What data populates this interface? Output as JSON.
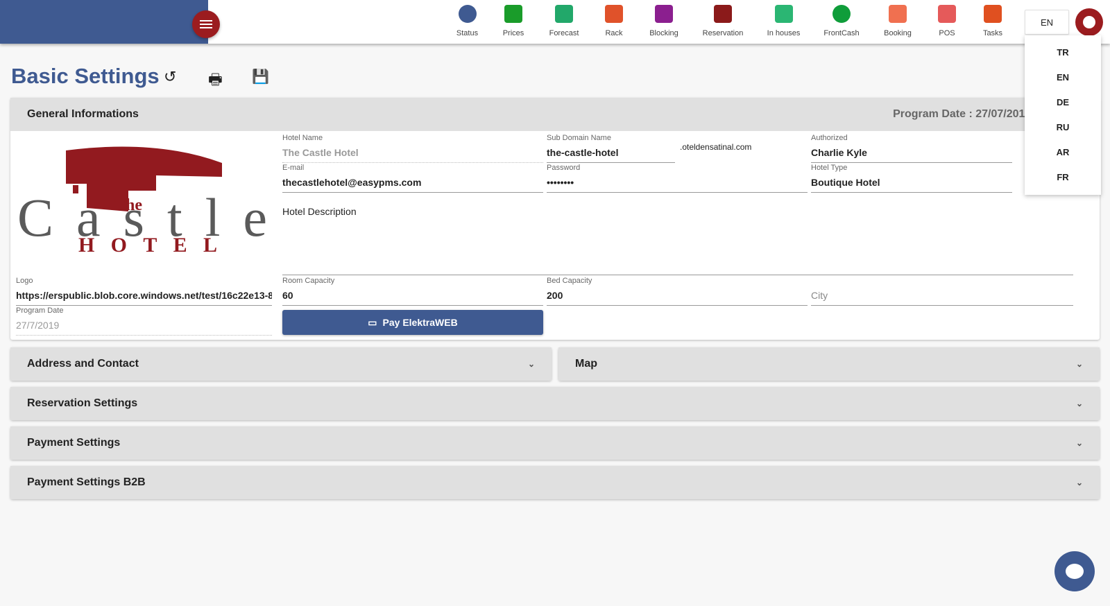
{
  "header": {
    "nav": [
      {
        "label": "Status",
        "icon": "status-pie-icon",
        "color": "#3f5a91"
      },
      {
        "label": "Prices",
        "icon": "prices-icon",
        "color": "#1a9c2a"
      },
      {
        "label": "Forecast",
        "icon": "forecast-chart-icon",
        "color": "#22a86a"
      },
      {
        "label": "Rack",
        "icon": "rack-grid-icon",
        "color": "#e0522a"
      },
      {
        "label": "Blocking",
        "icon": "calendar-icon",
        "color": "#8b1f8f"
      },
      {
        "label": "Reservation",
        "icon": "plane-landing-icon",
        "color": "#8b1a1a"
      },
      {
        "label": "In houses",
        "icon": "bed-icon",
        "color": "#2bb673"
      },
      {
        "label": "FrontCash",
        "icon": "dollar-icon",
        "color": "#0f9d3a"
      },
      {
        "label": "Booking",
        "icon": "hand-pointer-icon",
        "color": "#f07050"
      },
      {
        "label": "POS",
        "icon": "cart-icon",
        "color": "#e55a5a"
      },
      {
        "label": "Tasks",
        "icon": "alarm-icon",
        "color": "#e05020"
      }
    ],
    "language": "EN",
    "languages": [
      "TR",
      "EN",
      "DE",
      "RU",
      "AR",
      "FR"
    ]
  },
  "page": {
    "title": "Basic Settings"
  },
  "general": {
    "title": "General Informations",
    "program_date_text": "Program Date : 27/07/2019 HOTELID",
    "logo_text": {
      "the": "The",
      "castle": "Castle",
      "hotel": "HOTEL"
    },
    "hotel_name_label": "Hotel Name",
    "hotel_name": "The Castle Hotel",
    "subdomain_label": "Sub Domain Name",
    "subdomain": "the-castle-hotel",
    "subdomain_suffix": ".oteldensatinal.com",
    "authorized_label": "Authorized",
    "authorized": "Charlie Kyle",
    "email_label": "E-mail",
    "email": "thecastlehotel@easypms.com",
    "password_label": "Password",
    "password": "••••••••",
    "hotel_type_label": "Hotel Type",
    "hotel_type": "Boutique Hotel",
    "description_placeholder": "Hotel Description",
    "logo_label": "Logo",
    "logo_url": "https://erspublic.blob.core.windows.net/test/16c22e13-82e",
    "program_date_label": "Program Date",
    "program_date": "27/7/2019",
    "room_capacity_label": "Room Capacity",
    "room_capacity": "60",
    "bed_capacity_label": "Bed Capacity",
    "bed_capacity": "200",
    "city_placeholder": "City",
    "pay_button": "Pay ElektraWEB"
  },
  "sections": [
    "Address and Contact",
    "Map",
    "Reservation Settings",
    "Payment Settings",
    "Payment Settings B2B"
  ]
}
